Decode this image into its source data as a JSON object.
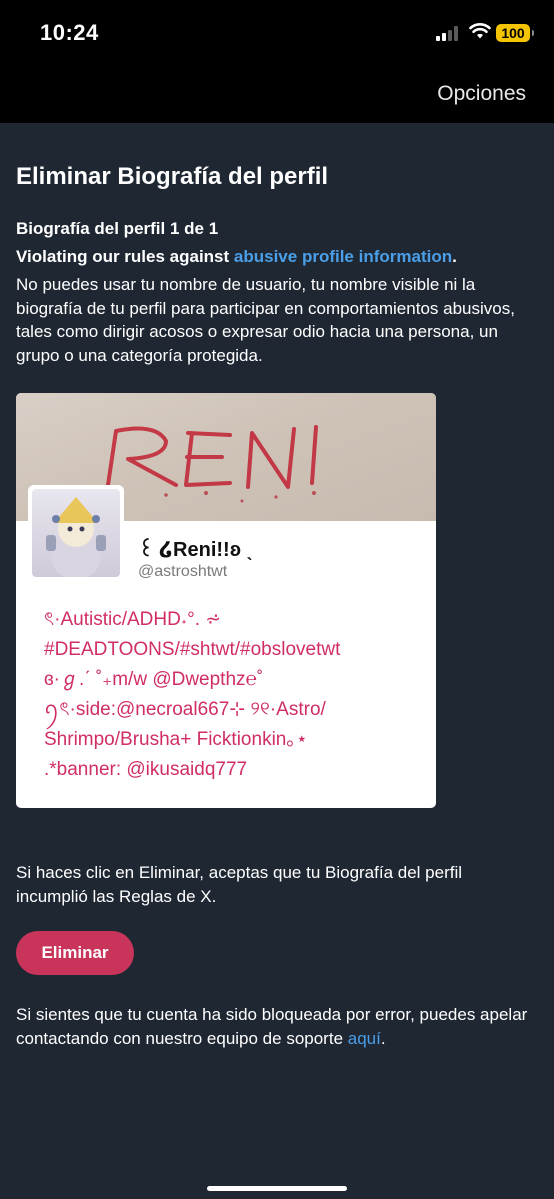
{
  "status_bar": {
    "time": "10:24",
    "battery": "100",
    "battery_color": "#f5c400"
  },
  "nav": {
    "options_label": "Opciones"
  },
  "page": {
    "title": "Eliminar Biografía del perfil",
    "bio_count": "Biografía del perfil 1 de 1",
    "violation_prefix": "Violating our rules against ",
    "violation_link": "abusive profile information",
    "violation_suffix": ".",
    "explanation": "No puedes usar tu nombre de usuario, tu nombre visible ni la biografía de tu perfil para participar en comportamientos abusivos, tales como dirigir acosos o expresar odio hacia una persona, un grupo o una categoría protegida."
  },
  "profile_card": {
    "banner_text": "RENI",
    "display_name": "꒰ ໒Reni!!ʚ ˎ",
    "handle": "@astroshtwt",
    "bio_lines": [
      "ৎ·Autistic/ADHD˖°. ⩫",
      "#DEADTOONS/#shtwt/#obslovetwt",
      "ɞ·ℊ.ˊ ˚₊m/w @Dwepthz℮˚",
      "ꪆৎ·side:@necroal667⊹ ୨୧·Astro/",
      "Shrimpo/Brusha+ Ficktionkin｡⋆",
      ".*banner: @ikusaidq777"
    ]
  },
  "consent": "Si haces clic en Eliminar, aceptas que tu Biografía del perfil incumplió las Reglas de X.",
  "delete_button": "Eliminar",
  "appeal": {
    "text": "Si sientes que tu cuenta ha sido bloqueada por error, puedes apelar contactando con nuestro equipo de soporte ",
    "link": "aquí",
    "suffix": "."
  },
  "colors": {
    "background": "#1f2733",
    "accent_link": "#4a9fe8",
    "button": "#c8345a",
    "bio_text": "#d02e63"
  }
}
